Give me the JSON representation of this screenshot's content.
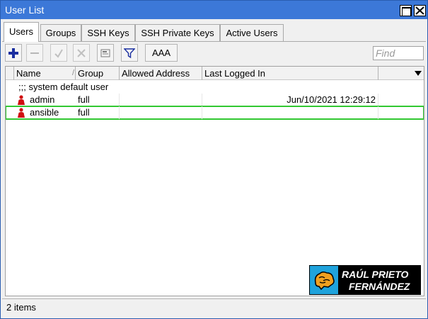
{
  "window": {
    "title": "User List",
    "accent": "#3c78d8"
  },
  "tabs": [
    {
      "label": "Users",
      "active": true
    },
    {
      "label": "Groups",
      "active": false
    },
    {
      "label": "SSH Keys",
      "active": false
    },
    {
      "label": "SSH Private Keys",
      "active": false
    },
    {
      "label": "Active Users",
      "active": false
    }
  ],
  "toolbar": {
    "add_icon": "plus-icon",
    "remove_icon": "minus-icon",
    "enable_icon": "check-icon",
    "disable_icon": "x-icon",
    "comment_icon": "note-icon",
    "filter_icon": "filter-icon",
    "aaa_label": "AAA",
    "find_placeholder": "Find"
  },
  "table": {
    "columns": [
      "Name",
      "Group",
      "Allowed Address",
      "Last Logged In"
    ],
    "sort_indicator": "/",
    "comment": ";;; system default user",
    "rows": [
      {
        "name": "admin",
        "group": "full",
        "allowed_address": "",
        "last_logged_in": "Jun/10/2021 12:29:12",
        "selected": false
      },
      {
        "name": "ansible",
        "group": "full",
        "allowed_address": "",
        "last_logged_in": "",
        "selected": true
      }
    ],
    "selection_color": "#32c832"
  },
  "watermark": {
    "line1": "RAÚL PRIETO",
    "line2": "FERNÁNDEZ",
    "color": "#1fa3dc"
  },
  "status": {
    "text": "2 items"
  }
}
